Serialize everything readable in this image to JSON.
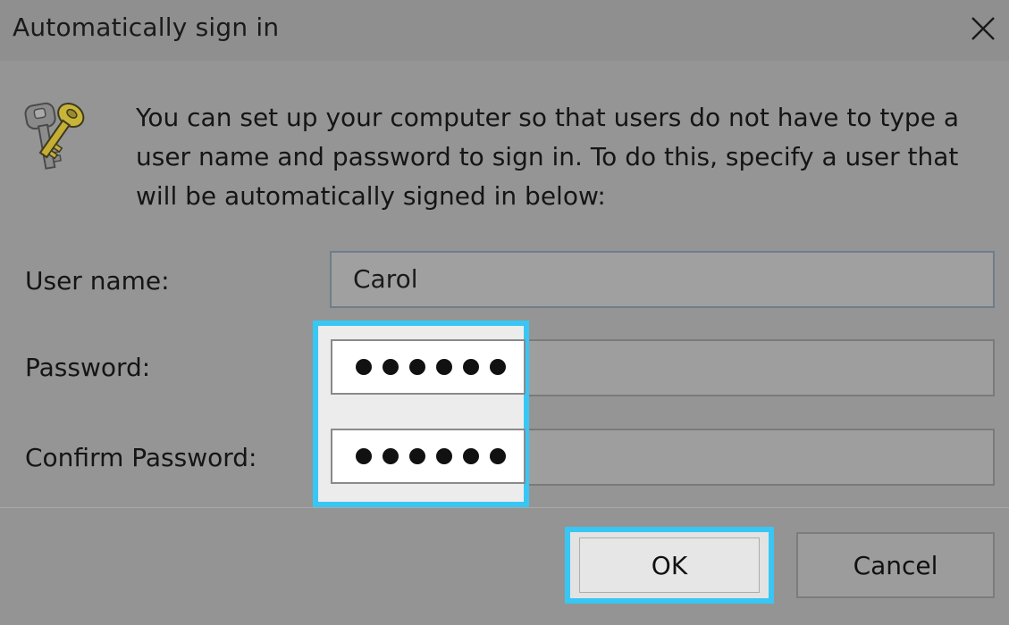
{
  "window": {
    "title": "Automatically sign in",
    "close_icon": "close-icon"
  },
  "description": "You can set up your computer so that users do not have to type a user name and password to sign in. To do this, specify a user that will be automatically signed in below:",
  "icon": "keys-icon",
  "form": {
    "username_label": "User name:",
    "username_value": "Carol",
    "password_label": "Password:",
    "password_dots": 6,
    "confirm_label": "Confirm Password:",
    "confirm_dots": 6
  },
  "buttons": {
    "ok_label": "OK",
    "cancel_label": "Cancel"
  },
  "colors": {
    "highlight": "#38c6f4",
    "dimmed_background": "#949494"
  }
}
